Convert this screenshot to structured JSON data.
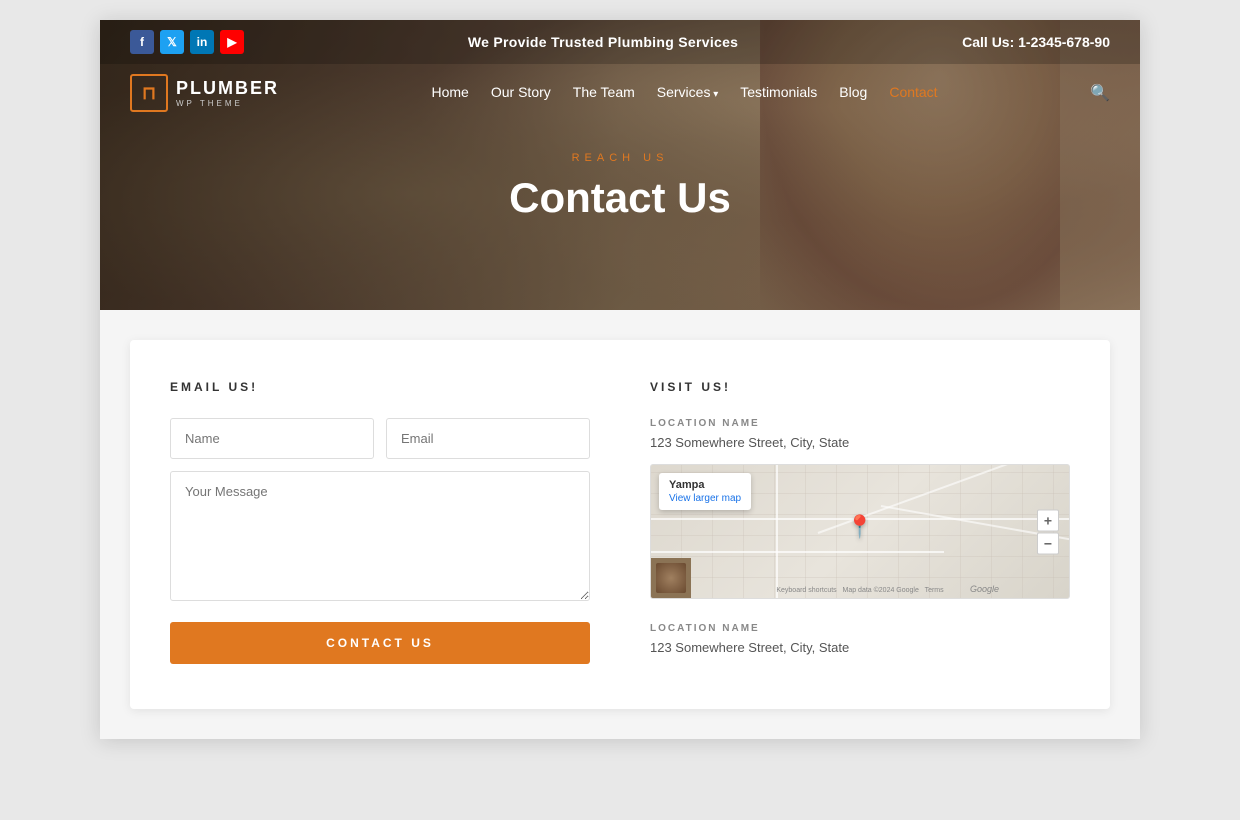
{
  "topbar": {
    "center_text": "We Provide Trusted Plumbing Services",
    "phone_label": "Call Us: 1-2345-678-90",
    "social": [
      {
        "name": "facebook",
        "label": "f",
        "class": "facebook"
      },
      {
        "name": "twitter",
        "label": "t",
        "class": "twitter"
      },
      {
        "name": "linkedin",
        "label": "in",
        "class": "linkedin"
      },
      {
        "name": "youtube",
        "label": "▶",
        "class": "youtube"
      }
    ]
  },
  "navbar": {
    "logo_main": "PLUMBER",
    "logo_sub": "WP THEME",
    "logo_icon": "⊓",
    "links": [
      {
        "label": "Home",
        "active": false,
        "has_arrow": false
      },
      {
        "label": "Our Story",
        "active": false,
        "has_arrow": false
      },
      {
        "label": "The Team",
        "active": false,
        "has_arrow": false
      },
      {
        "label": "Services",
        "active": false,
        "has_arrow": true
      },
      {
        "label": "Testimonials",
        "active": false,
        "has_arrow": false
      },
      {
        "label": "Blog",
        "active": false,
        "has_arrow": false
      },
      {
        "label": "Contact",
        "active": true,
        "has_arrow": false
      }
    ]
  },
  "hero": {
    "subtitle": "REACH US",
    "title": "Contact Us"
  },
  "form_section": {
    "title": "EMAIL US!",
    "name_placeholder": "Name",
    "email_placeholder": "Email",
    "message_placeholder": "Your Message",
    "button_label": "CONTACT US"
  },
  "visit_section": {
    "title": "VISIT US!",
    "locations": [
      {
        "label": "LOCATION NAME",
        "address": "123 Somewhere Street, City, State",
        "map_popup_title": "Yampa",
        "map_popup_link": "View larger map"
      },
      {
        "label": "LOCATION NAME",
        "address": "123 Somewhere Street, City, State"
      }
    ]
  }
}
